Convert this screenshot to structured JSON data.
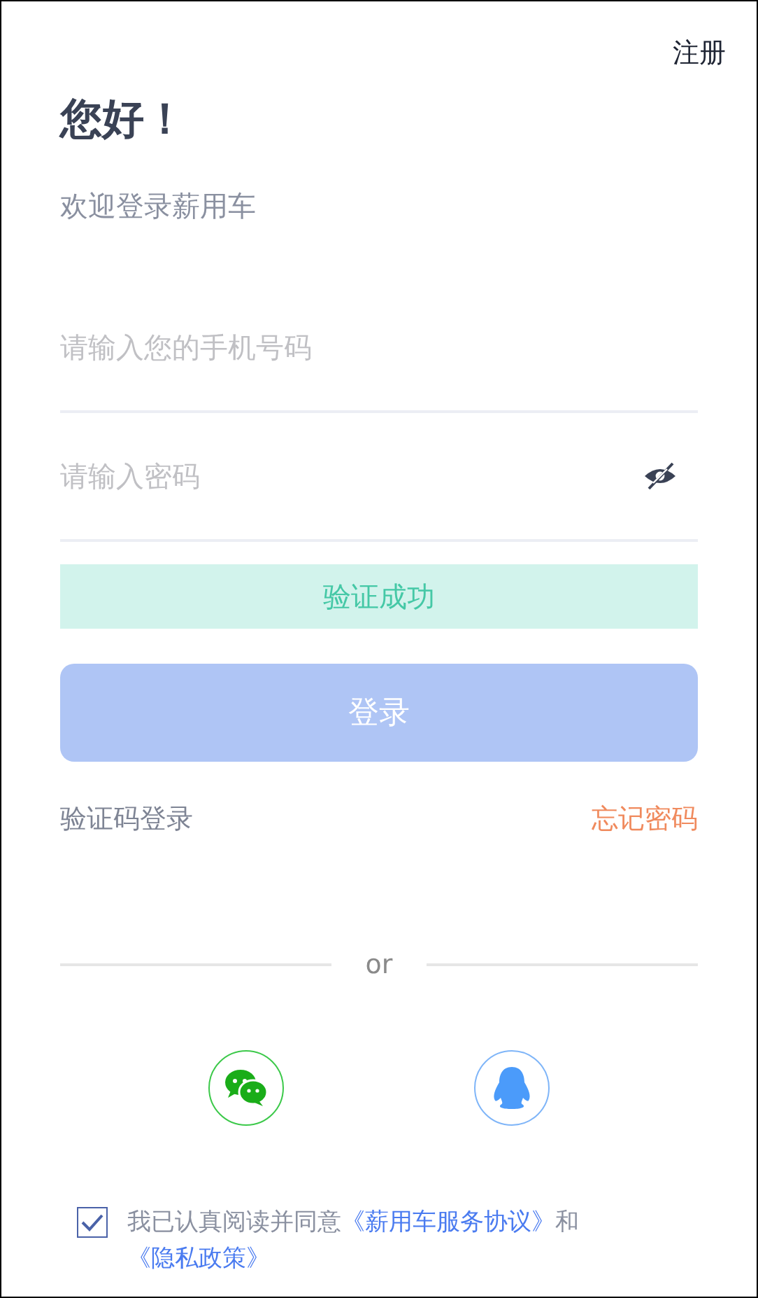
{
  "header": {
    "register_link": "注册"
  },
  "greeting": {
    "title": "您好！",
    "subtitle": "欢迎登录薪用车"
  },
  "fields": [
    {
      "kind": "phone",
      "placeholder": "请输入您的手机号码"
    },
    {
      "kind": "password",
      "placeholder": "请输入密码",
      "password_visible": false
    }
  ],
  "verification": {
    "text": "验证成功",
    "verified": true
  },
  "login_button": {
    "label": "登录",
    "disabled": true
  },
  "links": {
    "code_login": "验证码登录",
    "forgot_password": "忘记密码"
  },
  "divider": {
    "text": "or"
  },
  "social": [
    {
      "kind": "wechat"
    },
    {
      "kind": "qq"
    }
  ],
  "agreement": {
    "checked": true,
    "text": "我已认真阅读并同意",
    "terms_link": "《薪用车服务协议》",
    "conjunction": "和",
    "privacy_link": "《隐私政策》"
  }
}
